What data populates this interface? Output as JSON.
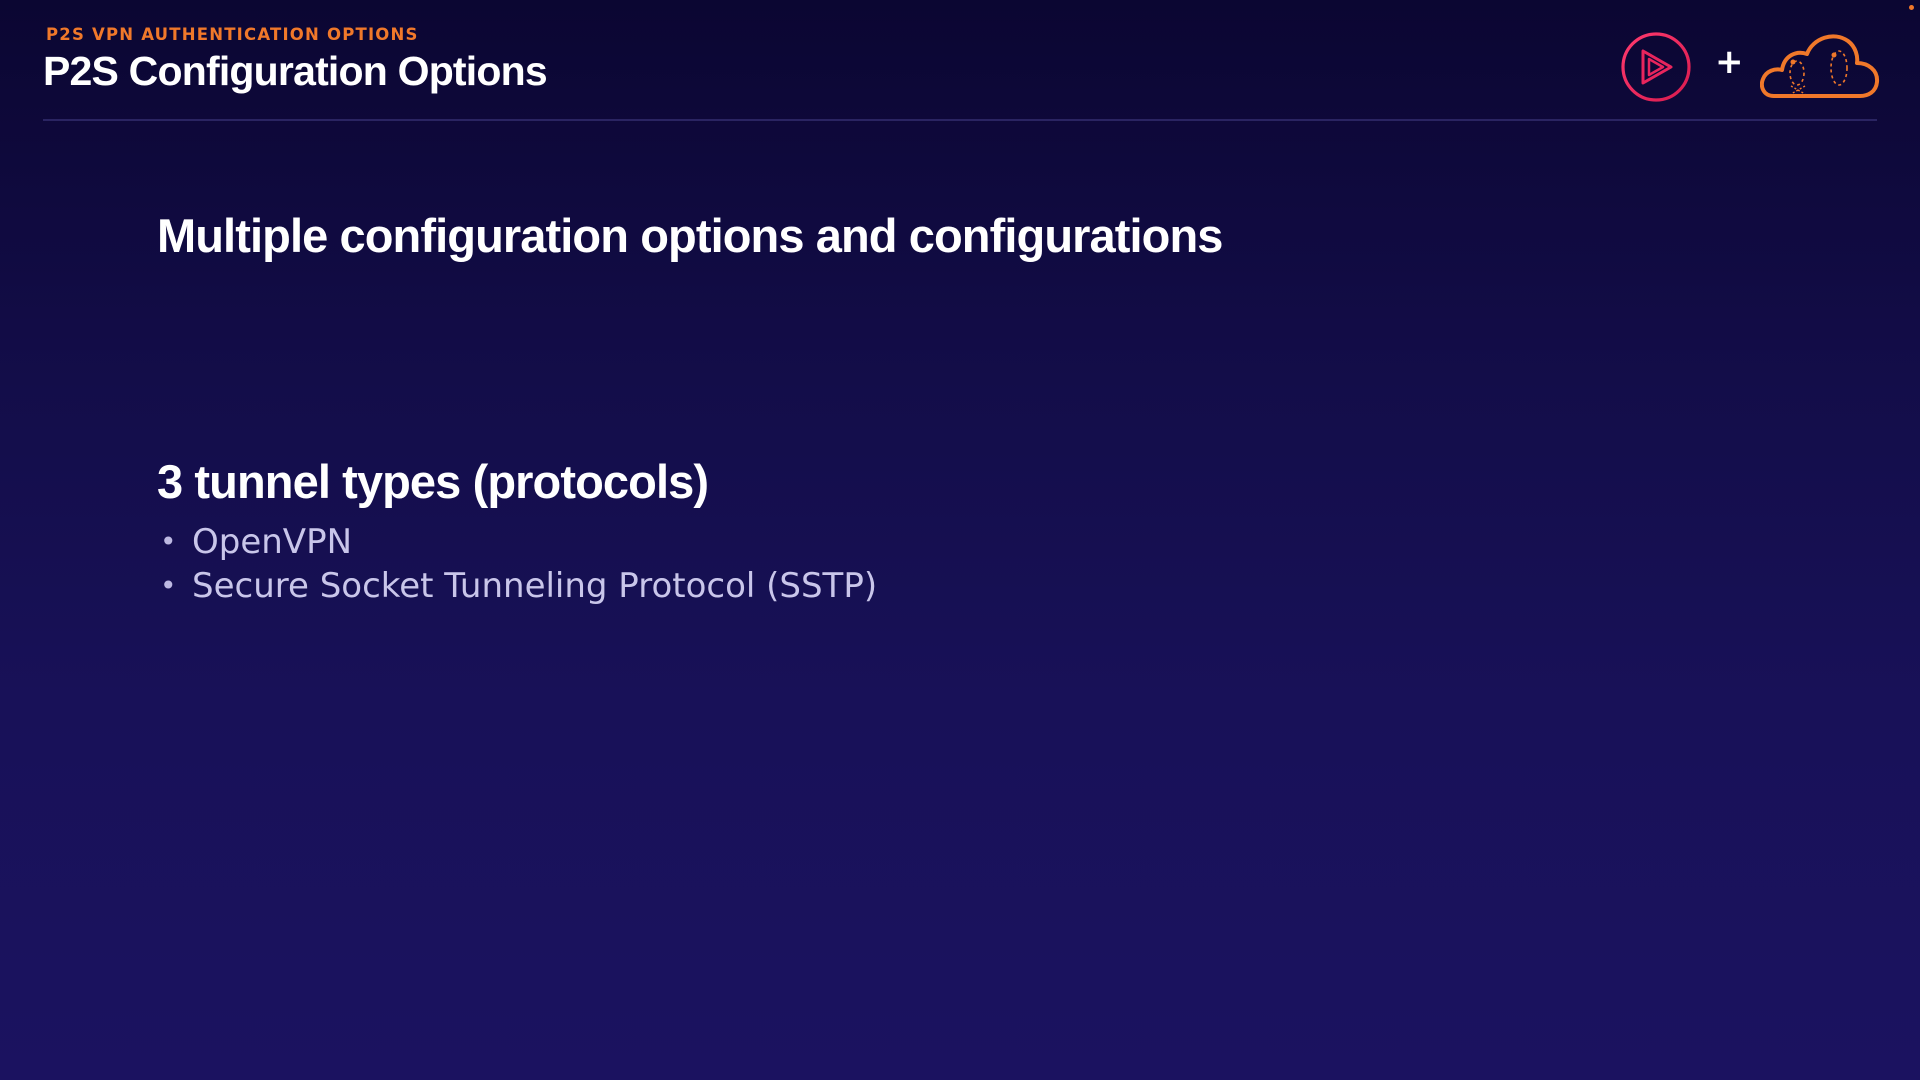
{
  "header": {
    "kicker": "P2S VPN AUTHENTICATION OPTIONS",
    "title": "P2S Configuration Options",
    "plus_symbol": "+",
    "logos": [
      {
        "icon": "play-logo-icon",
        "color": "#e8255d"
      },
      {
        "icon": "cloud-logo-icon",
        "color": "#f0782a"
      }
    ]
  },
  "content": {
    "headline": "Multiple configuration options and configurations",
    "section_heading": "3 tunnel types (protocols)",
    "bullet_symbol": "•",
    "bullets": [
      "OpenVPN",
      "Secure Socket Tunneling Protocol (SSTP)"
    ]
  },
  "colors": {
    "accent": "#f0782a",
    "play_logo": "#e8255d",
    "background_top": "#0b0632",
    "background_bottom": "#1b1260"
  }
}
